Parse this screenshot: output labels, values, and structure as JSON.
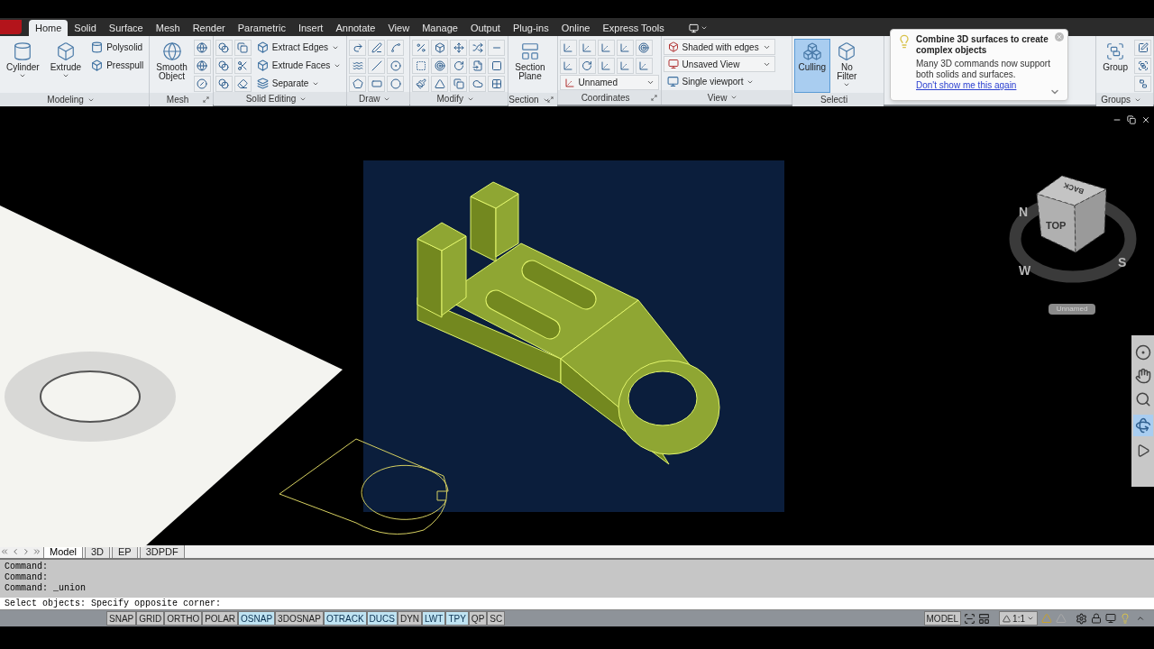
{
  "ribbon_tabs": [
    {
      "label": "Home",
      "selected": true
    },
    {
      "label": "Solid",
      "selected": false
    },
    {
      "label": "Surface",
      "selected": false
    },
    {
      "label": "Mesh",
      "selected": false
    },
    {
      "label": "Render",
      "selected": false
    },
    {
      "label": "Parametric",
      "selected": false
    },
    {
      "label": "Insert",
      "selected": false
    },
    {
      "label": "Annotate",
      "selected": false
    },
    {
      "label": "View",
      "selected": false
    },
    {
      "label": "Manage",
      "selected": false
    },
    {
      "label": "Output",
      "selected": false
    },
    {
      "label": "Plug-ins",
      "selected": false
    },
    {
      "label": "Online",
      "selected": false
    },
    {
      "label": "Express Tools",
      "selected": false
    }
  ],
  "panels": [
    {
      "title": "Modeling",
      "menu": true,
      "launcher": false,
      "columns": [
        [
          {
            "kind": "large",
            "label": "Cylinder",
            "dropdown": true,
            "selected": false
          }
        ],
        [
          {
            "kind": "large",
            "label": "Extrude",
            "dropdown": true,
            "selected": false
          }
        ],
        [
          {
            "kind": "small",
            "label": "Polysolid",
            "dropdown": false
          },
          {
            "kind": "small",
            "label": "Presspull",
            "dropdown": false
          }
        ]
      ]
    },
    {
      "title": "Mesh",
      "menu": false,
      "launcher": true,
      "columns": [
        [
          {
            "kind": "large",
            "label": "Smooth Object",
            "dropdown": false,
            "selected": false
          }
        ],
        [
          {
            "kind": "icons"
          },
          {
            "kind": "icons"
          },
          {
            "kind": "icons"
          }
        ]
      ]
    },
    {
      "title": "Solid Editing",
      "menu": true,
      "launcher": false,
      "columns": [
        [
          {
            "kind": "icons"
          },
          {
            "kind": "icons"
          },
          {
            "kind": "icons"
          }
        ],
        [
          {
            "kind": "small",
            "label": "Extract Edges",
            "dropdown": true
          },
          {
            "kind": "small",
            "label": "Extrude Faces",
            "dropdown": true
          },
          {
            "kind": "small",
            "label": "Separate",
            "dropdown": true
          }
        ]
      ]
    },
    {
      "title": "Draw",
      "menu": true,
      "launcher": false,
      "columns": [
        [
          {
            "kind": "icons"
          },
          {
            "kind": "icons"
          },
          {
            "kind": "icons"
          }
        ]
      ]
    },
    {
      "title": "Modify",
      "menu": true,
      "launcher": false,
      "columns": [
        [
          {
            "kind": "icons"
          },
          {
            "kind": "icons"
          },
          {
            "kind": "icons"
          }
        ]
      ]
    },
    {
      "title": "Section",
      "menu": true,
      "launcher": true,
      "columns": [
        [
          {
            "kind": "large",
            "label": "Section Plane",
            "dropdown": false,
            "selected": false
          }
        ]
      ]
    },
    {
      "title": "Coordinates",
      "menu": false,
      "launcher": true,
      "columns": [
        [
          {
            "kind": "icons"
          },
          {
            "kind": "icons"
          },
          {
            "kind": "combo",
            "label": "Unnamed"
          }
        ]
      ]
    },
    {
      "title": "View",
      "menu": true,
      "launcher": false,
      "columns": [
        [
          {
            "kind": "combo",
            "label": "Shaded with edges"
          },
          {
            "kind": "combo",
            "label": "Unsaved View"
          },
          {
            "kind": "small",
            "label": "Single viewport",
            "dropdown": true
          }
        ]
      ]
    },
    {
      "title": "Selecti",
      "menu": false,
      "launcher": false,
      "columns": [
        [
          {
            "kind": "large",
            "label": "Culling",
            "dropdown": false,
            "selected": true
          }
        ],
        [
          {
            "kind": "large",
            "label": "No Filter",
            "dropdown": true,
            "selected": false
          }
        ]
      ]
    },
    {
      "title": "Groups",
      "menu": true,
      "launcher": false,
      "columns": [
        [
          {
            "kind": "large",
            "label": "Group",
            "dropdown": false,
            "selected": false
          }
        ],
        [
          {
            "kind": "icons"
          },
          {
            "kind": "icons"
          },
          {
            "kind": "icons"
          }
        ]
      ]
    }
  ],
  "tooltip": {
    "title": "Combine 3D surfaces to create complex objects",
    "body": "Many 3D commands now support both solids and surfaces.",
    "link": "Don't show me this again"
  },
  "viewcube": {
    "faces": [
      "TOP",
      "BACK"
    ],
    "compass": [
      "N",
      "W",
      "S"
    ],
    "view_label": "Unnamed"
  },
  "layout_tabs": [
    {
      "label": "Model",
      "selected": true
    },
    {
      "label": "3D",
      "selected": false
    },
    {
      "label": "EP",
      "selected": false
    },
    {
      "label": "3DPDF",
      "selected": false
    }
  ],
  "command_history": [
    "Command:",
    "Command:",
    "Command: _union"
  ],
  "command_line": "Select objects: Specify opposite corner:",
  "status_toggles": [
    {
      "label": "SNAP",
      "on": false
    },
    {
      "label": "GRID",
      "on": false
    },
    {
      "label": "ORTHO",
      "on": false
    },
    {
      "label": "POLAR",
      "on": false
    },
    {
      "label": "OSNAP",
      "on": true
    },
    {
      "label": "3DOSNAP",
      "on": false
    },
    {
      "label": "OTRACK",
      "on": true
    },
    {
      "label": "DUCS",
      "on": true
    },
    {
      "label": "DYN",
      "on": false
    },
    {
      "label": "LWT",
      "on": true
    },
    {
      "label": "TPY",
      "on": true
    },
    {
      "label": "QP",
      "on": false
    },
    {
      "label": "SC",
      "on": false
    }
  ],
  "status_right": {
    "space": "MODEL",
    "annotation_scale": "1:1"
  }
}
